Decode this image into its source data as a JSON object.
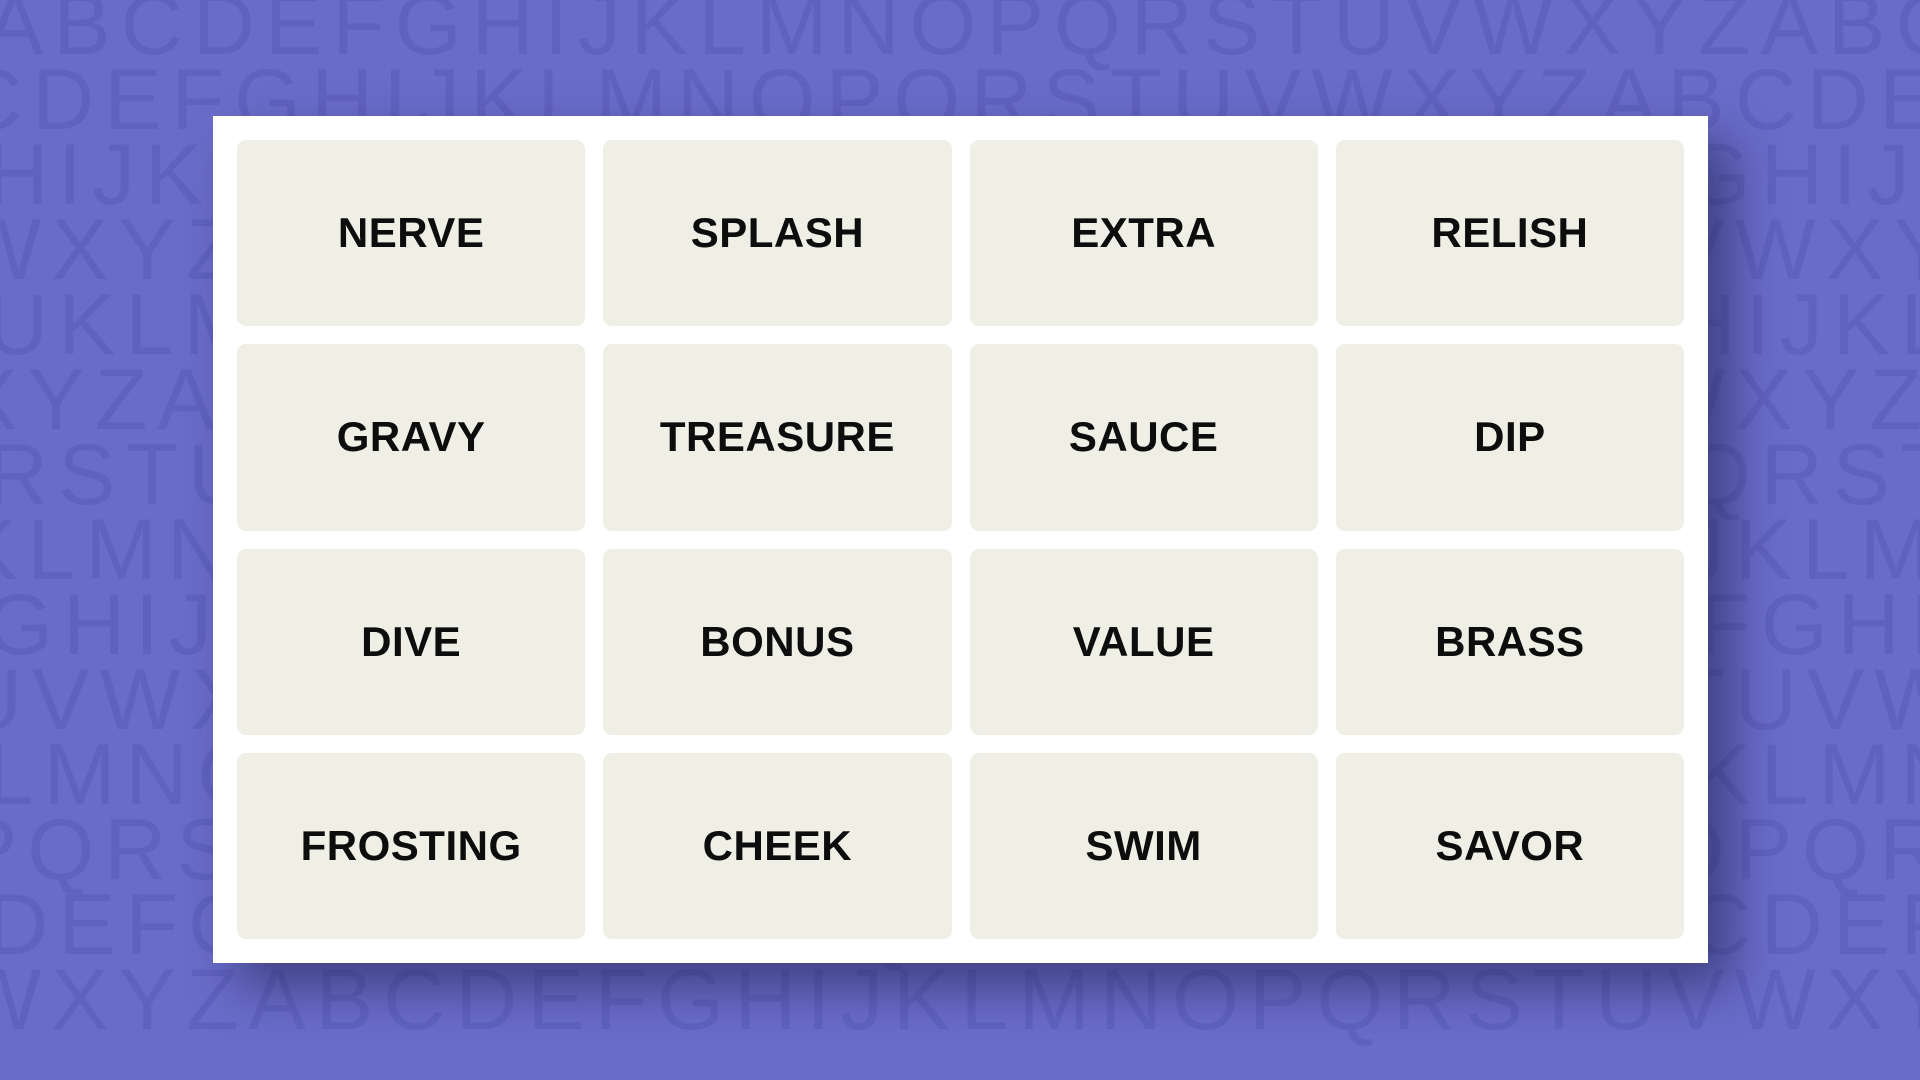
{
  "background": {
    "name": "alphabet-tile-pattern",
    "color": "#6b6cca",
    "letter_color": "#6162c0",
    "rows": [
      "ABCDEFGHIJKLMNOPQRSTUVWXYZABCDEFGHIJ",
      "CDEFGHIJKLMNOPQRSTUVWXYZABCDEFGHIJKL",
      "HIJKLMNOPQRSTUVWXYZABCDEFGHIJKLMNOPQ",
      "WXYZABCDEFGHIJKLMNOPQRSTUVWXYZABCDEF",
      "UKLMNOPQRSTUVWXYZABCDEFGHIJKLMNOPQRS",
      "XYZABCDEFGHIJKLMNOPQRSTUVWXYZABCDEFG",
      "RSTUVWXYZABCDEFGHIJKLMNOPQRSTUVWXYZA",
      "KLMNOPQRSTUVWXYZABCDEFGHIJKLMNOPQRST",
      "GHIJKLMNOPQRSTUVWXYZABCDEFGHIJKLMNOP",
      "UVWXYZABCDEFGHIJKLMNOPQRSTUVWXYZABCD",
      "LMNOPQRSTUVWXYZABCDEFGHIJKLMNOPQRSTU",
      "PQRSTUVWXYZABCDEFGHIJKLMNOPQRSTUVWXY",
      "DEFGHIJKLMNOPQRSTUVWXYZABCDEFGHIJKLM",
      "WXYZABCDEFGHIJKLMNOPQRSTUVWXYZABCDEF"
    ]
  },
  "board": {
    "name": "connections-puzzle-board",
    "surface_color": "#ffffff",
    "tile_color": "#efefe6",
    "tile_text_color": "#0d0d0d",
    "columns": 4,
    "rows": 4,
    "tiles": [
      {
        "word": "NERVE"
      },
      {
        "word": "SPLASH"
      },
      {
        "word": "EXTRA"
      },
      {
        "word": "RELISH"
      },
      {
        "word": "GRAVY"
      },
      {
        "word": "TREASURE"
      },
      {
        "word": "SAUCE"
      },
      {
        "word": "DIP"
      },
      {
        "word": "DIVE"
      },
      {
        "word": "BONUS"
      },
      {
        "word": "VALUE"
      },
      {
        "word": "BRASS"
      },
      {
        "word": "FROSTING"
      },
      {
        "word": "CHEEK"
      },
      {
        "word": "SWIM"
      },
      {
        "word": "SAVOR"
      }
    ]
  }
}
